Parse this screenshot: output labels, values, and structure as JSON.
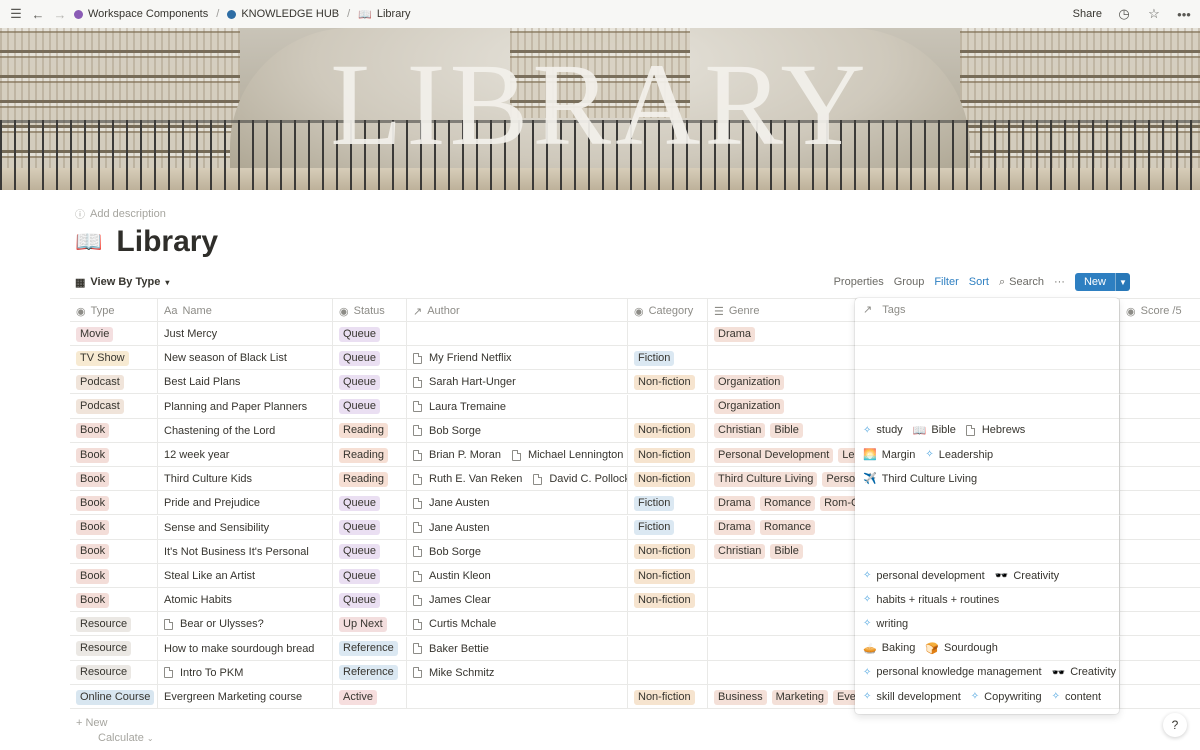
{
  "breadcrumbs": [
    {
      "label": "Workspace Components",
      "color": "#8a5bb5"
    },
    {
      "label": "KNOWLEDGE HUB",
      "color": "#2e6da4"
    },
    {
      "label": "Library",
      "icon": "book-icon"
    }
  ],
  "topbar": {
    "share_label": "Share"
  },
  "cover": {
    "title": "LIBRARY"
  },
  "page": {
    "add_description": "Add description",
    "title": "Library",
    "icon": "open-book-icon"
  },
  "viewbar": {
    "view_label": "View By Type",
    "properties": "Properties",
    "group": "Group",
    "filter": "Filter",
    "sort": "Sort",
    "search": "Search",
    "more": "···",
    "new": "New"
  },
  "columns": [
    "Type",
    "Name",
    "Status",
    "Author",
    "Category",
    "Genre",
    "Tags",
    "Score /5"
  ],
  "colors": {
    "movie": "#f4dfe0",
    "tvshow": "#f7ead2",
    "podcast": "#f0e4da",
    "book": "#f3ddd8",
    "resource": "#ebe8e4",
    "course": "#d8e6f0",
    "queue": "#eadff2",
    "reading": "#f6dfd4",
    "upnext": "#f3dede",
    "reference": "#dbe8f2",
    "active": "#f6dede",
    "fiction": "#dbe8f2",
    "nonfiction": "#f6e4cf",
    "genre": "#f4e0d8"
  },
  "rows": [
    {
      "type": "Movie",
      "type_c": "movie",
      "name": "Just Mercy",
      "status": "Queue",
      "status_c": "queue",
      "authors": [],
      "category": "",
      "cat_c": "",
      "genres": [
        "Drama"
      ],
      "tags": []
    },
    {
      "type": "TV Show",
      "type_c": "tvshow",
      "name": "New season of Black List",
      "status": "Queue",
      "status_c": "queue",
      "authors": [
        "My Friend Netflix"
      ],
      "category": "Fiction",
      "cat_c": "fiction",
      "genres": [],
      "tags": []
    },
    {
      "type": "Podcast",
      "type_c": "podcast",
      "name": "Best Laid Plans",
      "status": "Queue",
      "status_c": "queue",
      "authors": [
        "Sarah Hart-Unger"
      ],
      "category": "Non-fiction",
      "cat_c": "nonfiction",
      "genres": [
        "Organization"
      ],
      "tags": []
    },
    {
      "type": "Podcast",
      "type_c": "podcast",
      "name": "Planning and Paper Planners",
      "status": "Queue",
      "status_c": "queue",
      "authors": [
        "Laura Tremaine"
      ],
      "category": "",
      "cat_c": "",
      "genres": [
        "Organization"
      ],
      "tags": []
    },
    {
      "type": "Book",
      "type_c": "book",
      "name": "Chastening of the Lord",
      "status": "Reading",
      "status_c": "reading",
      "authors": [
        "Bob Sorge"
      ],
      "category": "Non-fiction",
      "cat_c": "nonfiction",
      "genres": [
        "Christian",
        "Bible"
      ],
      "tags": [
        {
          "icon": "diamond-icon",
          "g": "✧",
          "label": "study"
        },
        {
          "icon": "book-emoji-icon",
          "g": "📖",
          "label": "Bible"
        },
        {
          "icon": "page-icon",
          "g": "doc",
          "label": "Hebrews"
        }
      ]
    },
    {
      "type": "Book",
      "type_c": "book",
      "name": "12 week year",
      "status": "Reading",
      "status_c": "reading",
      "authors": [
        "Brian P. Moran",
        "Michael Lennington"
      ],
      "category": "Non-fiction",
      "cat_c": "nonfiction",
      "genres": [
        "Personal Development",
        "Lea"
      ],
      "tags": [
        {
          "icon": "sunset-icon",
          "g": "🌅",
          "label": "Margin"
        },
        {
          "icon": "diamond-icon",
          "g": "✧",
          "label": "Leadership"
        }
      ]
    },
    {
      "type": "Book",
      "type_c": "book",
      "name": "Third Culture Kids",
      "status": "Reading",
      "status_c": "reading",
      "authors": [
        "Ruth E. Van Reken",
        "David C. Pollock"
      ],
      "category": "Non-fiction",
      "cat_c": "nonfiction",
      "genres": [
        "Third Culture Living",
        "Person"
      ],
      "tags": [
        {
          "icon": "airplane-icon",
          "g": "✈️",
          "label": "Third Culture Living"
        }
      ]
    },
    {
      "type": "Book",
      "type_c": "book",
      "name": "Pride and Prejudice",
      "status": "Queue",
      "status_c": "queue",
      "authors": [
        "Jane Austen"
      ],
      "category": "Fiction",
      "cat_c": "fiction",
      "genres": [
        "Drama",
        "Romance",
        "Rom-Co"
      ],
      "tags": []
    },
    {
      "type": "Book",
      "type_c": "book",
      "name": "Sense and Sensibility",
      "status": "Queue",
      "status_c": "queue",
      "authors": [
        "Jane Austen"
      ],
      "category": "Fiction",
      "cat_c": "fiction",
      "genres": [
        "Drama",
        "Romance"
      ],
      "tags": []
    },
    {
      "type": "Book",
      "type_c": "book",
      "name": "It's Not Business It's Personal",
      "status": "Queue",
      "status_c": "queue",
      "authors": [
        "Bob Sorge"
      ],
      "category": "Non-fiction",
      "cat_c": "nonfiction",
      "genres": [
        "Christian",
        "Bible"
      ],
      "tags": []
    },
    {
      "type": "Book",
      "type_c": "book",
      "name": "Steal Like an Artist",
      "status": "Queue",
      "status_c": "queue",
      "authors": [
        "Austin Kleon"
      ],
      "category": "Non-fiction",
      "cat_c": "nonfiction",
      "genres": [],
      "tags": [
        {
          "icon": "diamond-icon",
          "g": "✧",
          "label": "personal development"
        },
        {
          "icon": "sunglasses-icon",
          "g": "🕶️",
          "label": "Creativity"
        }
      ]
    },
    {
      "type": "Book",
      "type_c": "book",
      "name": "Atomic Habits",
      "status": "Queue",
      "status_c": "queue",
      "authors": [
        "James Clear"
      ],
      "category": "Non-fiction",
      "cat_c": "nonfiction",
      "genres": [],
      "tags": [
        {
          "icon": "diamond-icon",
          "g": "✧",
          "label": "habits + rituals + routines"
        }
      ]
    },
    {
      "type": "Resource",
      "type_c": "resource",
      "name": "Bear or Ulysses?",
      "name_doc": true,
      "status": "Up Next",
      "status_c": "upnext",
      "authors": [
        "Curtis Mchale"
      ],
      "category": "",
      "cat_c": "",
      "genres": [],
      "tags": [
        {
          "icon": "diamond-icon",
          "g": "✧",
          "label": "writing"
        }
      ]
    },
    {
      "type": "Resource",
      "type_c": "resource",
      "name": "How to make sourdough bread",
      "status": "Reference",
      "status_c": "reference",
      "authors": [
        "Baker Bettie"
      ],
      "category": "",
      "cat_c": "",
      "genres": [],
      "tags": [
        {
          "icon": "pie-icon",
          "g": "🥧",
          "label": "Baking"
        },
        {
          "icon": "bread-icon",
          "g": "🍞",
          "label": "Sourdough"
        }
      ]
    },
    {
      "type": "Resource",
      "type_c": "resource",
      "name": "Intro To PKM",
      "name_doc": true,
      "status": "Reference",
      "status_c": "reference",
      "authors": [
        "Mike Schmitz"
      ],
      "category": "",
      "cat_c": "",
      "genres": [],
      "tags": [
        {
          "icon": "diamond-icon",
          "g": "✧",
          "label": "personal knowledge management"
        },
        {
          "icon": "sunglasses-icon",
          "g": "🕶️",
          "label": "Creativity"
        }
      ]
    },
    {
      "type": "Online Course",
      "type_c": "course",
      "name": "Evergreen Marketing course",
      "status": "Active",
      "status_c": "active",
      "authors": [],
      "category": "Non-fiction",
      "cat_c": "nonfiction",
      "genres": [
        "Business",
        "Marketing",
        "Ever"
      ],
      "tags": [
        {
          "icon": "diamond-icon",
          "g": "✧",
          "label": "skill development"
        },
        {
          "icon": "diamond-icon",
          "g": "✧",
          "label": "Copywriting"
        },
        {
          "icon": "diamond-icon",
          "g": "✧",
          "label": "content"
        }
      ]
    }
  ],
  "footer": {
    "new": "+ New",
    "calculate": "Calculate",
    "help": "?"
  }
}
